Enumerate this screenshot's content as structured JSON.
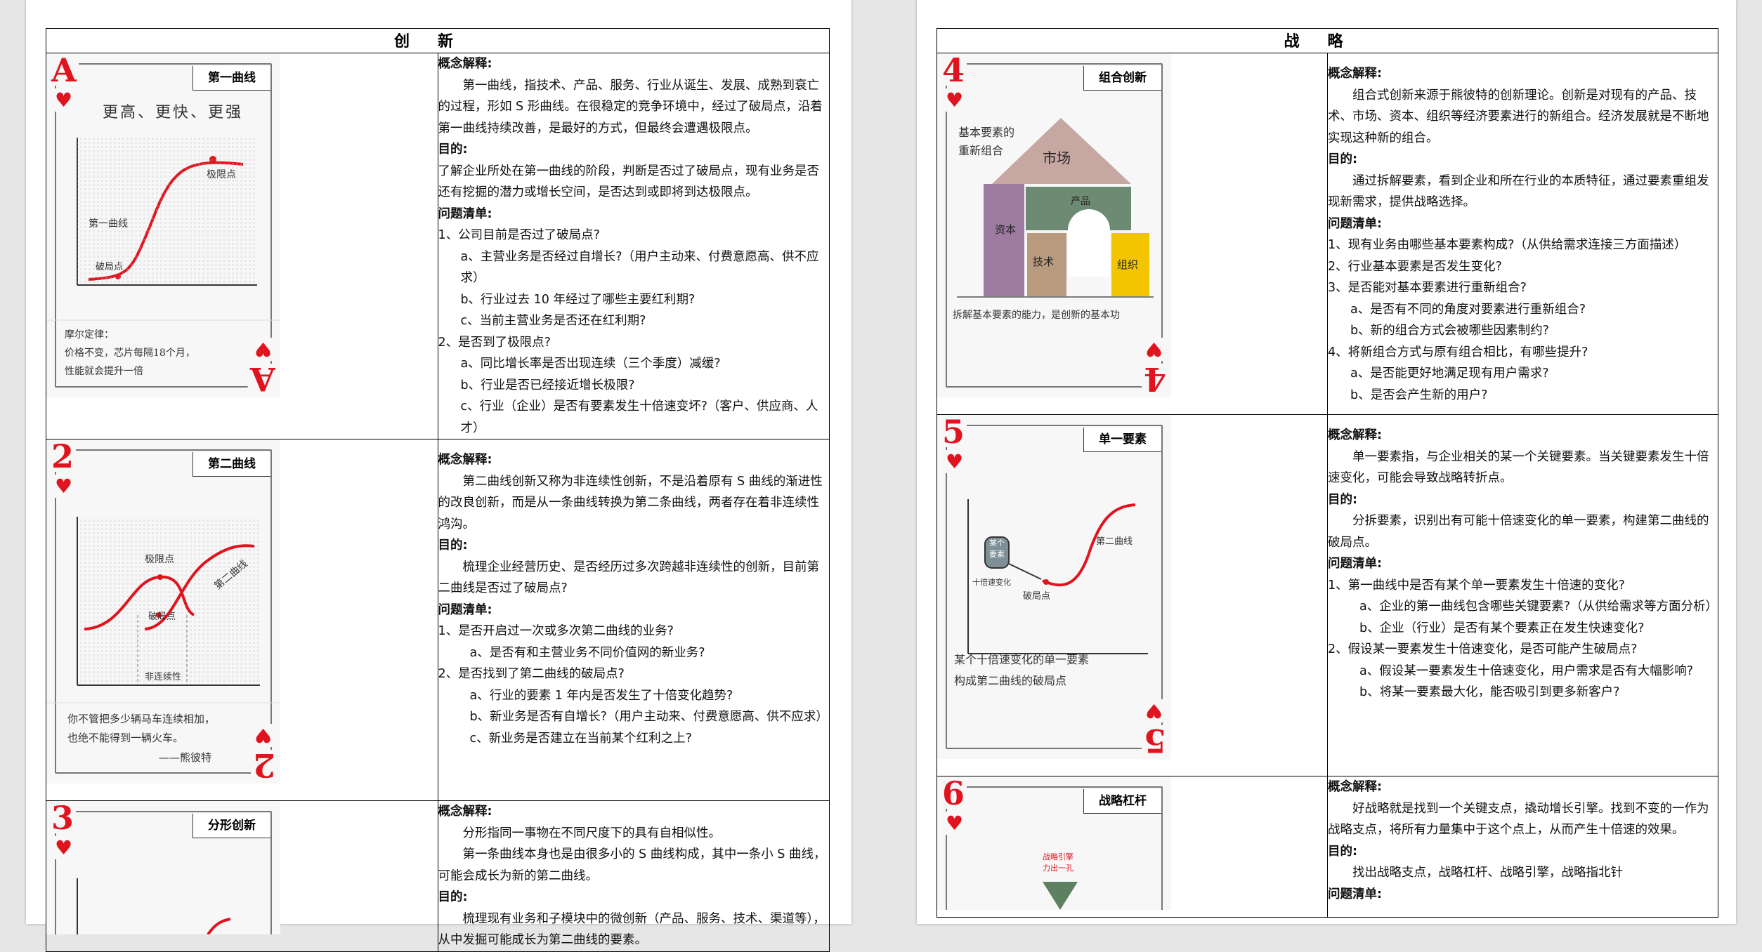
{
  "left": {
    "title": "创新",
    "rows": [
      {
        "card": {
          "rank": "A",
          "suit": "♥",
          "label": "第一曲线",
          "headline": "更高、更快、更强",
          "curve_label": "第一曲线",
          "break_label": "破局点",
          "limit_label": "极限点",
          "note_lines": [
            "摩尔定律：",
            "价格不变，芯片每隔18个月，",
            "性能就会提升一倍"
          ]
        },
        "lines": [
          {
            "t": "h",
            "text": "概念解释:"
          },
          {
            "t": "ind",
            "text": "第一曲线，指技术、产品、服务、行业从诞生、发展、成熟到衰亡的过程，形如 S 形曲线。在很稳定的竞争环境中，经过了破局点，沿着第一曲线持续改善，是最好的方式，但最终会遭遇极限点。"
          },
          {
            "t": "h",
            "text": "目的:"
          },
          {
            "t": "p",
            "text": "了解企业所处在第一曲线的阶段，判断是否过了破局点，现有业务是否还有挖掘的潜力或增长空间，是否达到或即将到达极限点。"
          },
          {
            "t": "h",
            "text": "问题清单:"
          },
          {
            "t": "p",
            "text": "1、公司目前是否过了破局点?"
          },
          {
            "t": "sub",
            "text": "a、主营业务是否经过自增长?（用户主动来、付费意愿高、供不应求）"
          },
          {
            "t": "sub",
            "text": "b、行业过去 10 年经过了哪些主要红利期?"
          },
          {
            "t": "sub",
            "text": "c、当前主营业务是否还在红利期?"
          },
          {
            "t": "p",
            "text": "2、是否到了极限点?"
          },
          {
            "t": "sub",
            "text": "a、同比增长率是否出现连续（三个季度）减缓?"
          },
          {
            "t": "sub",
            "text": "b、行业是否已经接近增长极限?"
          },
          {
            "t": "sub",
            "text": "c、行业（企业）是否有要素发生十倍速变坏?（客户、供应商、人才）"
          }
        ]
      },
      {
        "card": {
          "rank": "2",
          "suit": "♥",
          "label": "第二曲线",
          "limit_label": "极限点",
          "break_label": "破局点",
          "second_label": "第二曲线",
          "gap_label": "非连续性",
          "note_lines": [
            "你不管把多少辆马车连续相加，",
            "也绝不能得到一辆火车。",
            "——熊彼特"
          ]
        },
        "lines": [
          {
            "t": "blank",
            "text": ""
          },
          {
            "t": "h",
            "text": "概念解释:"
          },
          {
            "t": "ind",
            "text": "第二曲线创新又称为非连续性创新，不是沿着原有 S 曲线的渐进性的改良创新，而是从一条曲线转换为第二条曲线，两者存在着非连续性鸿沟。"
          },
          {
            "t": "h",
            "text": "目的:"
          },
          {
            "t": "ind",
            "text": "梳理企业经营历史、是否经历过多次跨越非连续性的创新，目前第二曲线是否过了破局点?"
          },
          {
            "t": "h",
            "text": "问题清单:"
          },
          {
            "t": "p",
            "text": "1、是否开启过一次或多次第二曲线的业务?"
          },
          {
            "t": "sub2",
            "text": "a、是否有和主营业务不同价值网的新业务?"
          },
          {
            "t": "p",
            "text": "2、是否找到了第二曲线的破局点?"
          },
          {
            "t": "sub2",
            "text": "a、行业的要素 1 年内是否发生了十倍变化趋势?"
          },
          {
            "t": "sub2",
            "text": "b、新业务是否有自增长?（用户主动来、付费意愿高、供不应求）"
          },
          {
            "t": "sub2",
            "text": "c、新业务是否建立在当前某个红利之上?"
          }
        ]
      },
      {
        "card": {
          "rank": "3",
          "suit": "♥",
          "label": "分形创新"
        },
        "lines": [
          {
            "t": "h",
            "text": "概念解释:"
          },
          {
            "t": "ind",
            "text": "分形指同一事物在不同尺度下的具有自相似性。"
          },
          {
            "t": "ind",
            "text": "第一条曲线本身也是由很多小的 S 曲线构成，其中一条小 S 曲线，可能会成长为新的第二曲线。"
          },
          {
            "t": "h",
            "text": "目的:"
          },
          {
            "t": "ind",
            "text": "梳理现有业务和子模块中的微创新（产品、服务、技术、渠道等），从中发掘可能成长为第二曲线的要素。"
          }
        ]
      }
    ]
  },
  "right": {
    "title": "战略",
    "rows": [
      {
        "card": {
          "rank": "4",
          "suit": "♥",
          "label": "组合创新",
          "top_note": [
            "基本要素的",
            "重新组合"
          ],
          "blocks": {
            "market": "市场",
            "product": "产品",
            "capital": "资本",
            "tech": "技术",
            "org": "组织"
          },
          "bottom_note": "拆解基本要素的能力，是创新的基本功",
          "colors": {
            "market": "#c6a7a1",
            "product": "#6d8b72",
            "capital": "#9d7aa0",
            "tech": "#b89a7e",
            "org": "#f2c500"
          }
        },
        "lines": [
          {
            "t": "blank",
            "text": ""
          },
          {
            "t": "h",
            "text": "概念解释:"
          },
          {
            "t": "ind",
            "text": "组合式创新来源于熊彼特的创新理论。创新是对现有的产品、技术、市场、资本、组织等经济要素进行的新组合。经济发展就是不断地实现这种新的组合。"
          },
          {
            "t": "h",
            "text": "目的:"
          },
          {
            "t": "ind",
            "text": "通过拆解要素，看到企业和所在行业的本质特征，通过要素重组发现新需求，提供战略选择。"
          },
          {
            "t": "h",
            "text": "问题清单:"
          },
          {
            "t": "p",
            "text": "1、现有业务由哪些基本要素构成?（从供给需求连接三方面描述）"
          },
          {
            "t": "p",
            "text": "2、行业基本要素是否发生变化?"
          },
          {
            "t": "p",
            "text": "3、是否能对基本要素进行重新组合?"
          },
          {
            "t": "sub",
            "text": "a、是否有不同的角度对要素进行重新组合?"
          },
          {
            "t": "sub",
            "text": "b、新的组合方式会被哪些因素制约?"
          },
          {
            "t": "p",
            "text": "4、将新组合方式与原有组合相比，有哪些提升?"
          },
          {
            "t": "sub",
            "text": "a、是否能更好地满足现有用户需求?"
          },
          {
            "t": "sub",
            "text": "b、是否会产生新的用户?"
          }
        ]
      },
      {
        "card": {
          "rank": "5",
          "suit": "♥",
          "label": "单一要素",
          "rock_text": [
            "某个",
            "要素"
          ],
          "tenx_label": "十倍速变化",
          "break_label": "破局点",
          "second_label": "第二曲线",
          "note_lines": [
            "某个十倍速变化的单一要素",
            "构成第二曲线的破局点"
          ]
        },
        "lines": [
          {
            "t": "blank",
            "text": ""
          },
          {
            "t": "h",
            "text": "概念解释:"
          },
          {
            "t": "ind",
            "text": "单一要素指，与企业相关的某一个关键要素。当关键要素发生十倍速变化，可能会导致战略转折点。"
          },
          {
            "t": "h",
            "text": "目的:"
          },
          {
            "t": "ind",
            "text": "分拆要素，识别出有可能十倍速变化的单一要素，构建第二曲线的破局点。"
          },
          {
            "t": "h",
            "text": "问题清单:"
          },
          {
            "t": "p",
            "text": "1、第一曲线中是否有某个单一要素发生十倍速的变化?"
          },
          {
            "t": "sub2",
            "text": "a、企业的第一曲线包含哪些关键要素?（从供给需求等方面分析）"
          },
          {
            "t": "sub2",
            "text": "b、企业（行业）是否有某个要素正在发生快速变化?"
          },
          {
            "t": "p",
            "text": "2、假设某一要素发生十倍速变化，是否可能产生破局点?"
          },
          {
            "t": "sub2",
            "text": "a、假设某一要素发生十倍速变化，用户需求是否有大幅影响?"
          },
          {
            "t": "sub2",
            "text": "b、将某一要素最大化，能否吸引到更多新客户?"
          }
        ]
      },
      {
        "card": {
          "rank": "6",
          "suit": "♥",
          "label": "战略杠杆",
          "small_note": [
            "战略引擎",
            "力出一孔"
          ]
        },
        "lines": [
          {
            "t": "h",
            "text": "概念解释:"
          },
          {
            "t": "ind",
            "text": "好战略就是找到一个关键支点，撬动增长引擎。找到不变的一作为战略支点，将所有力量集中于这个点上，从而产生十倍速的效果。"
          },
          {
            "t": "h",
            "text": "目的:"
          },
          {
            "t": "ind",
            "text": "找出战略支点，战略杠杆、战略引擎，战略指北针"
          },
          {
            "t": "h",
            "text": "问题清单:"
          }
        ]
      }
    ]
  }
}
